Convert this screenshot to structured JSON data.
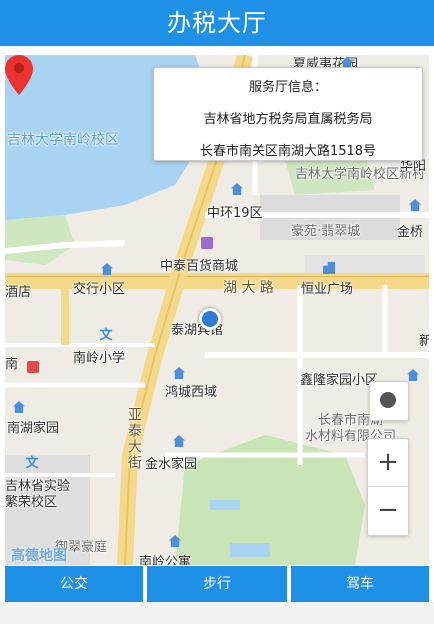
{
  "header": {
    "title": "办税大厅"
  },
  "info_popup": {
    "title": "服务厅信息：",
    "name": "吉林省地方税务局直属税务局",
    "address": "长春市南关区南湖大路1518号"
  },
  "map": {
    "labels": {
      "north_campus": "夏威夷花园",
      "university": "吉林大学南岭校区",
      "university_new": "吉林大学南岭校区新村",
      "huayuan": "华阳",
      "zhonghuan": "中环19区",
      "haoyuan": "豪苑·翡翠城",
      "jinqiao": "金桥",
      "zhongtai": "中泰百货商城",
      "jiaoxing": "交行小区",
      "hotel_left": "酒店",
      "nanhu_road": "湖 大 路",
      "hengye": "恒业广场",
      "taihu": "泰湖宾馆",
      "nanling_school": "南岭小学",
      "hongcheng": "鸿城西域",
      "xinlong": "鑫隆家园小区",
      "yatai_street": "亚泰大街",
      "nanhu_home": "南湖家园",
      "changchun_water": "长春市南湖",
      "water_material": "水材料有限公司",
      "jinshui": "金水家园",
      "provincial_school": "吉林省实验",
      "fanrong": "繁荣校区",
      "yucui": "御翠豪庭",
      "nanling_gongyu": "南岭公寓",
      "nan": "南",
      "xin": "新",
      "school_symbol": "文"
    },
    "logo": "高德地图",
    "controls": {
      "zoom_in": "+",
      "zoom_out": "−"
    }
  },
  "tabs": [
    {
      "label": "公交"
    },
    {
      "label": "步行"
    },
    {
      "label": "驾车"
    }
  ]
}
